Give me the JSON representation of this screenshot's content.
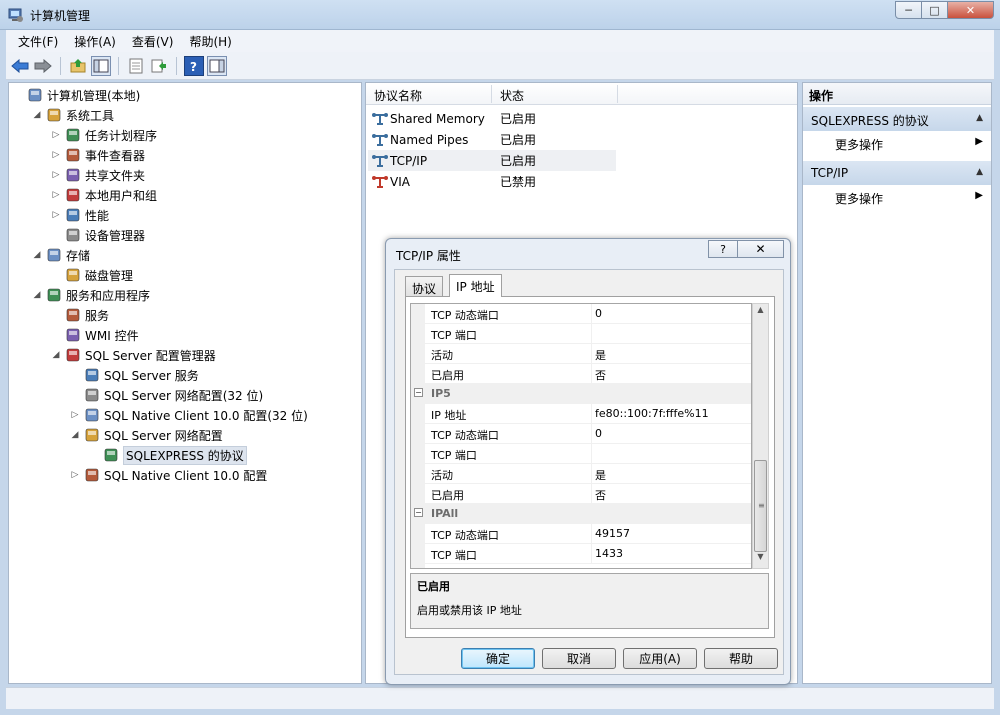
{
  "window": {
    "title": "计算机管理",
    "min_glyph": "─",
    "max_glyph": "□",
    "close_glyph": "✕"
  },
  "menubar": [
    "文件(F)",
    "操作(A)",
    "查看(V)",
    "帮助(H)"
  ],
  "toolbar": {
    "buttons": [
      "back-arrow-icon",
      "forward-arrow-icon",
      "up-folder-icon",
      "show-tree-icon",
      "properties-icon",
      "export-icon",
      "help-icon",
      "action-pane-icon"
    ]
  },
  "tree": {
    "items": [
      {
        "label": "计算机管理(本地)",
        "level": 0,
        "exp": "",
        "icon": "computer-management-icon"
      },
      {
        "label": "系统工具",
        "level": 1,
        "exp": "◢",
        "icon": "system-tools-icon"
      },
      {
        "label": "任务计划程序",
        "level": 2,
        "exp": "▷",
        "icon": "task-scheduler-icon"
      },
      {
        "label": "事件查看器",
        "level": 2,
        "exp": "▷",
        "icon": "event-viewer-icon"
      },
      {
        "label": "共享文件夹",
        "level": 2,
        "exp": "▷",
        "icon": "shared-folders-icon"
      },
      {
        "label": "本地用户和组",
        "level": 2,
        "exp": "▷",
        "icon": "users-groups-icon"
      },
      {
        "label": "性能",
        "level": 2,
        "exp": "▷",
        "icon": "performance-icon"
      },
      {
        "label": "设备管理器",
        "level": 2,
        "exp": "",
        "icon": "device-manager-icon"
      },
      {
        "label": "存储",
        "level": 1,
        "exp": "◢",
        "icon": "storage-icon"
      },
      {
        "label": "磁盘管理",
        "level": 2,
        "exp": "",
        "icon": "disk-management-icon"
      },
      {
        "label": "服务和应用程序",
        "level": 1,
        "exp": "◢",
        "icon": "services-apps-icon"
      },
      {
        "label": "服务",
        "level": 2,
        "exp": "",
        "icon": "services-icon"
      },
      {
        "label": "WMI 控件",
        "level": 2,
        "exp": "",
        "icon": "wmi-control-icon"
      },
      {
        "label": "SQL Server 配置管理器",
        "level": 2,
        "exp": "◢",
        "icon": "sql-config-manager-icon"
      },
      {
        "label": "SQL Server 服务",
        "level": 3,
        "exp": "",
        "icon": "sql-services-icon"
      },
      {
        "label": "SQL Server 网络配置(32 位)",
        "level": 3,
        "exp": "",
        "icon": "sql-network-icon"
      },
      {
        "label": "SQL Native Client 10.0 配置(32 位)",
        "level": 3,
        "exp": "▷",
        "icon": "native-client-icon"
      },
      {
        "label": "SQL Server 网络配置",
        "level": 3,
        "exp": "◢",
        "icon": "sql-network-icon"
      },
      {
        "label": "SQLEXPRESS 的协议",
        "level": 4,
        "exp": "",
        "icon": "protocols-icon",
        "selected": true
      },
      {
        "label": "SQL Native Client 10.0 配置",
        "level": 3,
        "exp": "▷",
        "icon": "native-client-icon"
      }
    ]
  },
  "list": {
    "columns": [
      "协议名称",
      "状态"
    ],
    "rows": [
      {
        "name": "Shared Memory",
        "state": "已启用"
      },
      {
        "name": "Named Pipes",
        "state": "已启用"
      },
      {
        "name": "TCP/IP",
        "state": "已启用"
      },
      {
        "name": "VIA",
        "state": "已禁用"
      }
    ]
  },
  "actions": {
    "header": "操作",
    "sections": [
      {
        "title": "SQLEXPRESS 的协议",
        "item": "更多操作"
      },
      {
        "title": "TCP/IP",
        "item": "更多操作"
      }
    ]
  },
  "dialog": {
    "title": "TCP/IP 属性",
    "help_glyph": "?",
    "close_glyph": "✕",
    "tabs": [
      "协议",
      "IP 地址"
    ],
    "grid": [
      {
        "key": "TCP 动态端口",
        "value": "0"
      },
      {
        "key": "TCP 端口",
        "value": ""
      },
      {
        "key": "活动",
        "value": "是"
      },
      {
        "key": "已启用",
        "value": "否"
      },
      {
        "key": "IP5",
        "value": "",
        "category": true
      },
      {
        "key": "IP 地址",
        "value": "fe80::100:7f:fffe%11"
      },
      {
        "key": "TCP 动态端口",
        "value": "0"
      },
      {
        "key": "TCP 端口",
        "value": ""
      },
      {
        "key": "活动",
        "value": "是"
      },
      {
        "key": "已启用",
        "value": "否"
      },
      {
        "key": "IPAll",
        "value": "",
        "category": true
      },
      {
        "key": "TCP 动态端口",
        "value": "49157"
      },
      {
        "key": "TCP 端口",
        "value": "1433"
      }
    ],
    "description": {
      "title": "已启用",
      "text": "启用或禁用该 IP 地址"
    },
    "buttons": {
      "ok": "确定",
      "cancel": "取消",
      "apply": "应用(A)",
      "help": "帮助"
    }
  },
  "colors": {
    "accent": "#3c7fb1",
    "frame": "#c5d6ea"
  }
}
